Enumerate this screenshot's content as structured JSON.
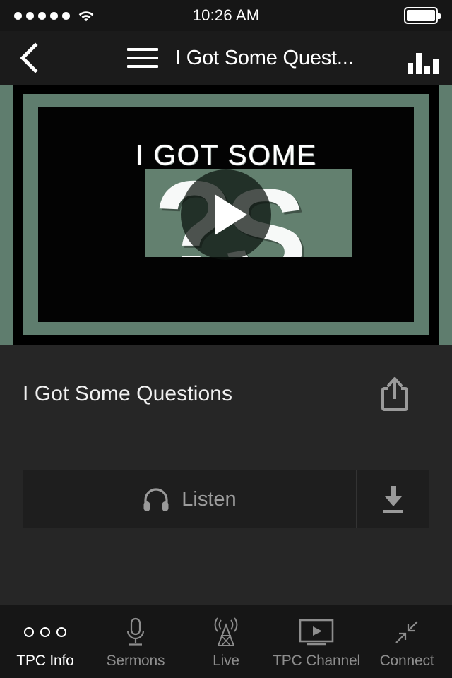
{
  "status_bar": {
    "signal_dots": 5,
    "signal_icon": "signal-dots-icon",
    "wifi_icon": "wifi-icon",
    "time": "10:26 AM",
    "battery_icon": "battery-full-icon",
    "battery_level": 100
  },
  "nav_bar": {
    "back_icon": "chevron-left-icon",
    "menu_icon": "hamburger-menu-icon",
    "title": "I Got Some Quest...",
    "chart_icon": "bar-chart-icon",
    "chart_bars": [
      14,
      26,
      10,
      18
    ]
  },
  "player": {
    "play_icon": "play-icon",
    "artwork": {
      "headline": "I GOT SOME",
      "glyph_question": "?",
      "glyph_s": "S",
      "background_color": "#5f7d6e",
      "frame_color": "#000000",
      "panel_color": "#63806f"
    }
  },
  "detail": {
    "title": "I Got Some Questions",
    "share_icon": "share-icon",
    "listen_label": "Listen",
    "listen_icon": "headphones-icon",
    "download_icon": "download-icon"
  },
  "tab_bar": {
    "active_index": 0,
    "tabs": [
      {
        "label": "TPC Info",
        "icon": "three-circles-icon"
      },
      {
        "label": "Sermons",
        "icon": "microphone-icon"
      },
      {
        "label": "Live",
        "icon": "broadcast-tower-icon"
      },
      {
        "label": "TPC Channel",
        "icon": "tv-play-icon"
      },
      {
        "label": "Connect",
        "icon": "collapse-arrows-icon"
      }
    ]
  },
  "colors": {
    "background": "#262626",
    "bar_background": "#161616",
    "accent_green": "#5f7d6e",
    "text_primary": "#ffffff",
    "text_muted": "#8d8d8d"
  }
}
